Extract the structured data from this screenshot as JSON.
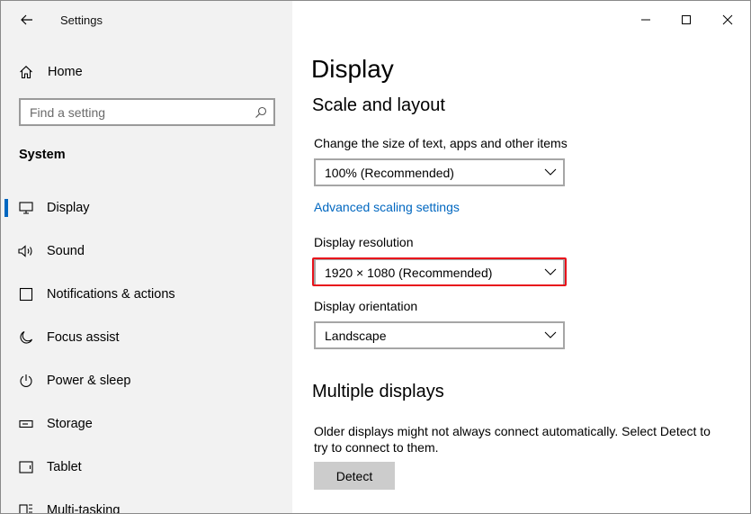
{
  "app": {
    "title": "Settings"
  },
  "sidebar": {
    "home_label": "Home",
    "search_placeholder": "Find a setting",
    "group_heading": "System",
    "items": [
      {
        "label": "Display",
        "icon": "monitor-icon",
        "active": true
      },
      {
        "label": "Sound",
        "icon": "speaker-icon"
      },
      {
        "label": "Notifications & actions",
        "icon": "notification-icon"
      },
      {
        "label": "Focus assist",
        "icon": "moon-icon"
      },
      {
        "label": "Power & sleep",
        "icon": "power-icon"
      },
      {
        "label": "Storage",
        "icon": "storage-icon"
      },
      {
        "label": "Tablet",
        "icon": "tablet-icon"
      },
      {
        "label": "Multi-tasking",
        "icon": "multitasking-icon"
      }
    ]
  },
  "main": {
    "title": "Display",
    "scale_section": {
      "title": "Scale and layout",
      "scale_label": "Change the size of text, apps and other items",
      "scale_value": "100% (Recommended)",
      "advanced_link": "Advanced scaling settings",
      "resolution_label": "Display resolution",
      "resolution_value": "1920 × 1080 (Recommended)",
      "orientation_label": "Display orientation",
      "orientation_value": "Landscape"
    },
    "multiple_section": {
      "title": "Multiple displays",
      "description": "Older displays might not always connect automatically. Select Detect to try to connect to them.",
      "detect_label": "Detect"
    }
  },
  "colors": {
    "accent": "#0067c0",
    "highlight": "#e8121b",
    "sidebar_bg": "#f2f2f2",
    "button_bg": "#cccccc"
  }
}
